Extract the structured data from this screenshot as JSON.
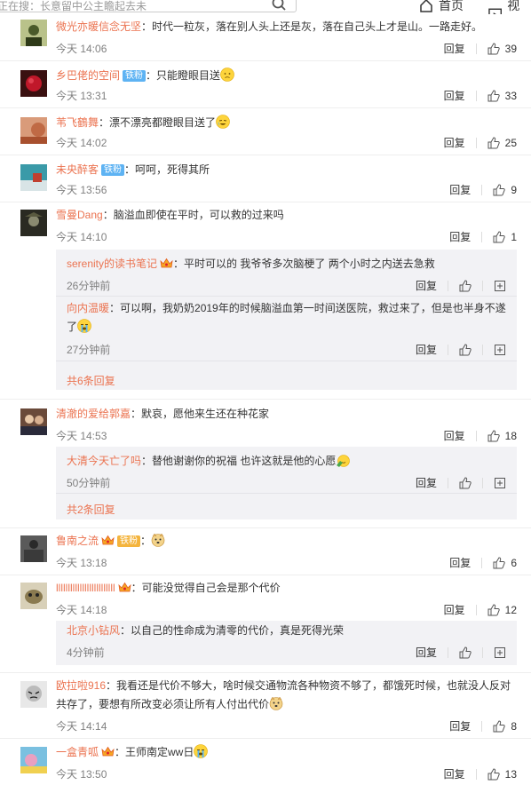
{
  "topbar": {
    "search_text": "正在搜：长意留中公主瞻起去未",
    "home": "首页",
    "video": "视频"
  },
  "colors": {
    "username": "#eb7350",
    "badge_iron": "#5eb3f3",
    "badge_fan": "#f4b43d"
  },
  "labels": {
    "reply": "回复",
    "forward_icon": "share"
  },
  "comments": [
    {
      "user": "微光亦暖信念无坚",
      "text": "：时代一粒灰，落在别人头上还是灰，落在自己头上才是山。一路走好。",
      "time": "今天 14:06",
      "likes": "39"
    },
    {
      "user": "乡巴佬的空间",
      "badge": "铁粉",
      "text": "：只能瞪眼目送",
      "emoji": "sad",
      "time": "今天 13:31",
      "likes": "33"
    },
    {
      "user": "苇飞鶴舞",
      "text": "：漂不漂亮都瞪眼目送了",
      "emoji": "cry",
      "time": "今天 14:02",
      "likes": "25"
    },
    {
      "user": "未央醉客",
      "badge": "铁粉",
      "text": "：呵呵，死得其所",
      "time": "今天 13:56",
      "likes": "9"
    },
    {
      "user": "雪曼Dang",
      "text": "：脑溢血即使在平时，可以救的过来吗",
      "time": "今天 14:10",
      "likes": "1",
      "subs": [
        {
          "user": "serenity的读书笔记",
          "crown": true,
          "text": "：平时可以的 我爷爷多次脑梗了 两个小时之内送去急救",
          "time": "26分钟前"
        },
        {
          "user": "向内温暖",
          "text": "：可以啊，我奶奶2019年的时候脑溢血第一时间送医院，救过来了，但是也半身不遂了",
          "emoji": "tears",
          "time": "27分钟前"
        }
      ],
      "more": "共6条回复"
    },
    {
      "user": "清澈的爱给郭嘉",
      "text": "：默哀，愿他来生还在种花家",
      "time": "今天 14:53",
      "likes": "18",
      "subs": [
        {
          "user": "大清今天亡了吗",
          "text": "：替他谢谢你的祝福 也许这就是他的心愿",
          "emoji": "salute",
          "time": "50分钟前"
        }
      ],
      "more": "共2条回复"
    },
    {
      "user": "鲁南之流",
      "crown": true,
      "badge": "铁粉",
      "text": "：",
      "emoji": "doge",
      "time": "今天 13:18",
      "likes": "6"
    },
    {
      "user": "lllllllllllllllllllllllll",
      "crown": true,
      "text": "：可能没觉得自己会是那个代价",
      "time": "今天 14:18",
      "likes": "12",
      "subs": [
        {
          "user": "北京小钻风",
          "text": "：以自己的性命成为清零的代价，真是死得光荣",
          "time": "4分钟前"
        }
      ]
    },
    {
      "user": "欧拉啦916",
      "text": "：我看还是代价不够大，啥时候交通物流各种物资不够了，都饿死时候，也就没人反对共存了，要想有所改变必须让所有人付出代价",
      "emoji": "doge",
      "time": "今天 14:14",
      "likes": "8"
    },
    {
      "user": "一盒青呱",
      "crown": true,
      "text": "：王师南定ww日",
      "emoji": "tears",
      "time": "今天 13:50",
      "likes": "13"
    }
  ]
}
